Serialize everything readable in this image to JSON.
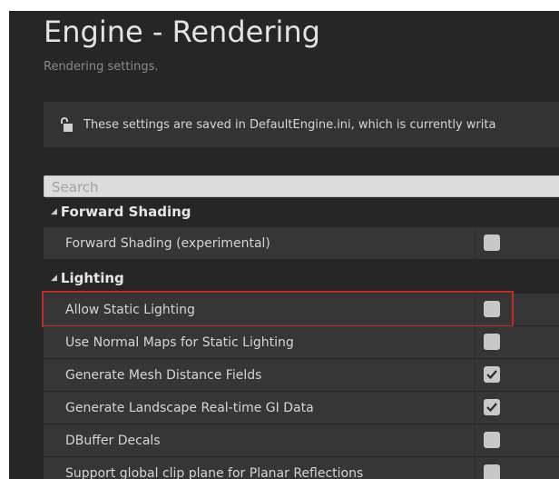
{
  "page": {
    "title": "Engine - Rendering",
    "subtitle": "Rendering settings."
  },
  "notice": {
    "icon": "lock-icon",
    "text": "These settings are saved in DefaultEngine.ini, which is currently writa"
  },
  "search": {
    "placeholder": "Search"
  },
  "sections": [
    {
      "label": "Forward Shading",
      "rows": [
        {
          "label": "Forward Shading (experimental)",
          "checked": false
        }
      ]
    },
    {
      "label": "Lighting",
      "rows": [
        {
          "label": "Allow Static Lighting",
          "checked": false,
          "highlighted": true
        },
        {
          "label": "Use Normal Maps for Static Lighting",
          "checked": false
        },
        {
          "label": "Generate Mesh Distance Fields",
          "checked": true
        },
        {
          "label": "Generate Landscape Real-time GI Data",
          "checked": true
        },
        {
          "label": "DBuffer Decals",
          "checked": false
        },
        {
          "label": "Support global clip plane for Planar Reflections",
          "checked": false
        }
      ]
    }
  ],
  "colors": {
    "highlight": "#c62828",
    "panel": "#262626",
    "row": "#363636"
  }
}
